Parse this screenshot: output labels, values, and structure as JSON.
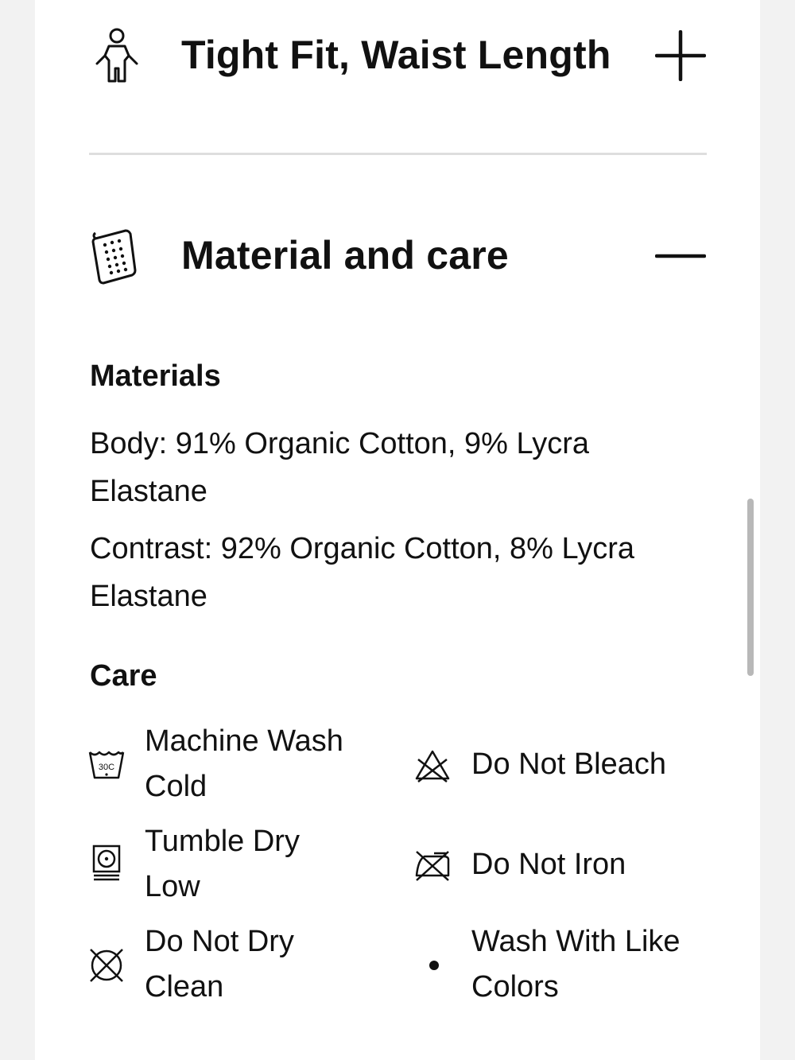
{
  "sections": {
    "fit": {
      "title": "Tight Fit, Waist Length",
      "icon": "body-fit-icon",
      "toggle": "plus-icon",
      "expanded": false
    },
    "material": {
      "title": "Material and care",
      "icon": "fabric-swatch-icon",
      "toggle": "minus-icon",
      "expanded": true,
      "materials_heading": "Materials",
      "materials": [
        "Body: 91% Organic Cotton, 9% Lycra Elastane",
        "Contrast: 92% Organic Cotton, 8% Lycra Elastane"
      ],
      "care_heading": "Care",
      "care": [
        {
          "label": "Machine Wash Cold",
          "icon": "wash-30c-icon"
        },
        {
          "label": "Do Not Bleach",
          "icon": "do-not-bleach-icon"
        },
        {
          "label": "Tumble Dry Low",
          "icon": "tumble-dry-low-icon"
        },
        {
          "label": "Do Not Iron",
          "icon": "do-not-iron-icon"
        },
        {
          "label": "Do Not Dry Clean",
          "icon": "do-not-dry-clean-icon"
        },
        {
          "label": "Wash With Like Colors",
          "icon": "bullet-dot-icon"
        }
      ],
      "wash_temperature": "30C"
    }
  }
}
